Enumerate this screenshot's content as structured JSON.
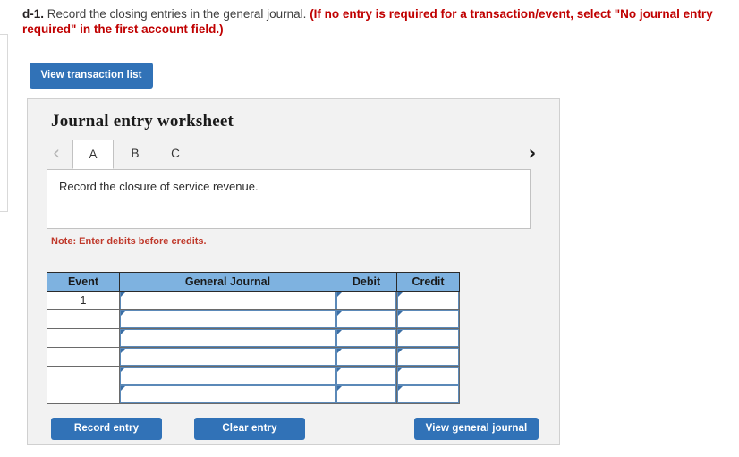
{
  "prompt": {
    "number": "d-1.",
    "text": " Record the closing entries in the general journal. ",
    "red_note": "(If no entry is required for a transaction/event, select \"No journal entry required\" in the first account field.)"
  },
  "toolbar": {
    "view_transaction_list_label": "View transaction list"
  },
  "worksheet": {
    "title": "Journal entry worksheet",
    "prev_arrow": "‹",
    "next_arrow": "›",
    "tabs": [
      {
        "label": "A",
        "active": true
      },
      {
        "label": "B",
        "active": false
      },
      {
        "label": "C",
        "active": false
      }
    ],
    "instruction": "Record the closure of service revenue.",
    "note": "Note: Enter debits before credits."
  },
  "table": {
    "headers": [
      "Event",
      "General Journal",
      "Debit",
      "Credit"
    ],
    "rows": [
      {
        "event": "1",
        "general_journal": "",
        "debit": "",
        "credit": ""
      },
      {
        "event": "",
        "general_journal": "",
        "debit": "",
        "credit": ""
      },
      {
        "event": "",
        "general_journal": "",
        "debit": "",
        "credit": ""
      },
      {
        "event": "",
        "general_journal": "",
        "debit": "",
        "credit": ""
      },
      {
        "event": "",
        "general_journal": "",
        "debit": "",
        "credit": ""
      },
      {
        "event": "",
        "general_journal": "",
        "debit": "",
        "credit": ""
      }
    ]
  },
  "actions": {
    "record_entry_label": "Record entry",
    "clear_entry_label": "Clear entry",
    "view_general_journal_label": "View general journal"
  },
  "colors": {
    "button_blue": "#3172b7",
    "header_blue": "#7eb2e0",
    "note_red": "#c0392b",
    "prompt_red": "#c00000",
    "panel_gray": "#f2f2f2",
    "input_border_blue": "#5b89b8"
  }
}
